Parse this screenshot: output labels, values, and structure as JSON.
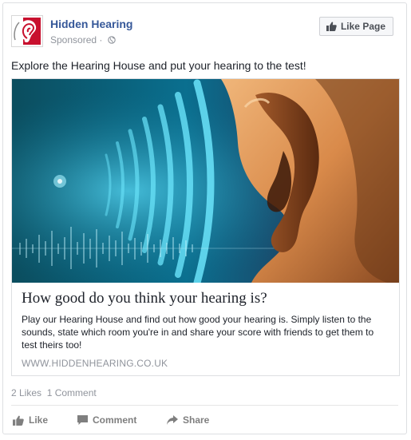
{
  "post": {
    "page_name": "Hidden Hearing",
    "sponsored": "Sponsored",
    "separator": " · ",
    "like_page_label": "Like Page",
    "text": "Explore the Hearing House and put your hearing to the test!"
  },
  "link": {
    "headline": "How good do you think your hearing is?",
    "description": "Play our Hearing House and find out how good your hearing is. Simply listen to the sounds, state which room you're in and share your score with friends to get them to test theirs too!",
    "domain": "WWW.HIDDENHEARING.CO.UK"
  },
  "engagement": {
    "likes": "2 Likes",
    "comments": "1 Comment"
  },
  "actions": {
    "like": "Like",
    "comment": "Comment",
    "share": "Share"
  },
  "icons": {
    "logo": "hidden-hearing-logo",
    "globe": "globe-icon",
    "thumbs_up": "thumbs-up-icon",
    "comment": "comment-icon",
    "share": "share-arrow-icon"
  },
  "colors": {
    "link_blue": "#365899",
    "logo_red": "#c8102e",
    "meta_gray": "#90949c",
    "action_gray": "#7f7f7f"
  }
}
